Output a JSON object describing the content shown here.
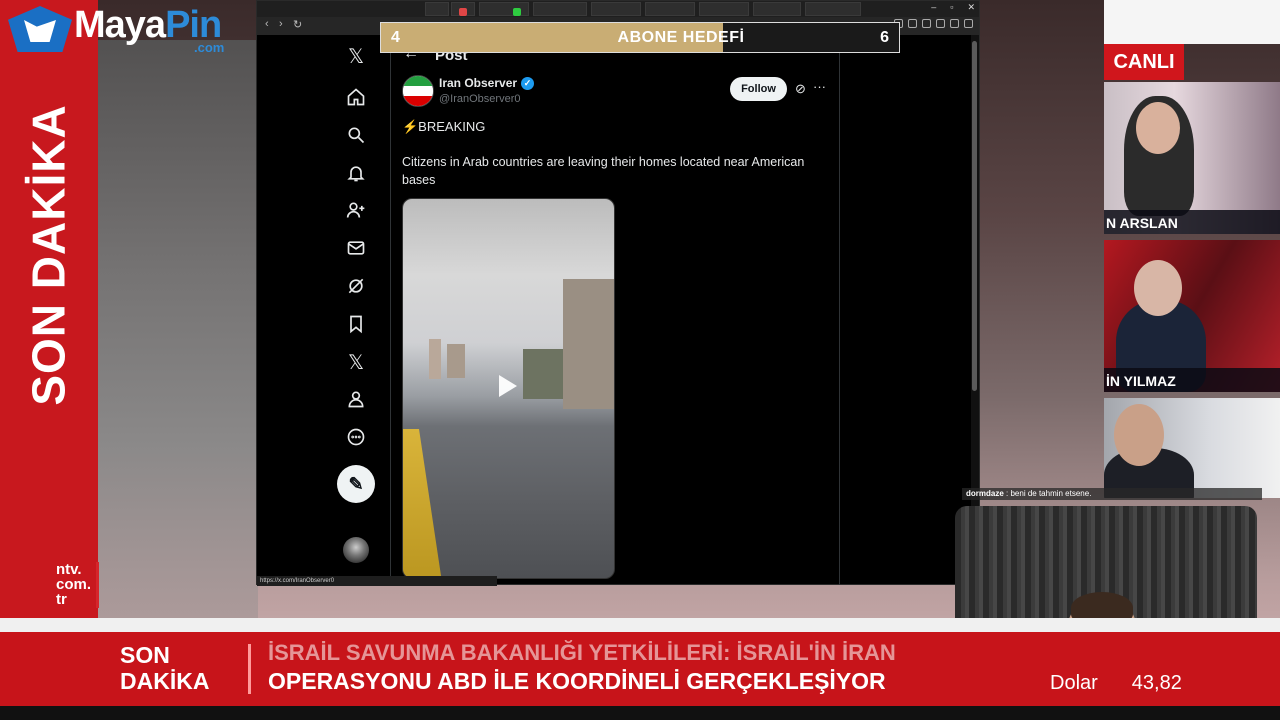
{
  "overlay": {
    "logo_word_a": "Maya",
    "logo_word_b": "Pin",
    "logo_domain": ".com",
    "abone_goal": {
      "left_value": "4",
      "label": "ABONE HEDEFİ",
      "right_value": "6",
      "progress_fraction": 0.66
    },
    "chat_message": {
      "user": "dormdaze",
      "text": ": beni de tahmin etsene."
    }
  },
  "tv": {
    "left_band_text": "SON DAKİKA",
    "channel_logo": "ntv.\ncom.\ntr",
    "live_badge": "CANLI",
    "panel_names": [
      "N ARSLAN",
      "İN YILMAZ"
    ],
    "ticker": {
      "label_line1": "SON",
      "label_line2": "DAKİKA",
      "headline_line1": "İSRAİL SAVUNMA BAKANLIĞI YETKİLİLERİ: İSRAİL'İN İRAN",
      "headline_line2": "OPERASYONU ABD İLE KOORDİNELİ GERÇEKLEŞİYOR",
      "currency_name": "Dolar",
      "currency_value": "43,82"
    }
  },
  "browser": {
    "status_url": "https://x.com/IranObserver0",
    "page_header": "Post",
    "sidebar_icons": [
      "x-logo-icon",
      "home-icon",
      "search-icon",
      "notifications-icon",
      "follow-icon",
      "messages-icon",
      "grok-icon",
      "bookmarks-icon",
      "premium-icon",
      "profile-icon",
      "more-icon"
    ],
    "post": {
      "author_name": "Iran Observer",
      "author_handle": "@IranObserver0",
      "follow_label": "Follow",
      "more_label": "···",
      "breaking": "⚡BREAKING",
      "text": "Citizens in Arab countries are leaving their homes located near American bases"
    }
  }
}
